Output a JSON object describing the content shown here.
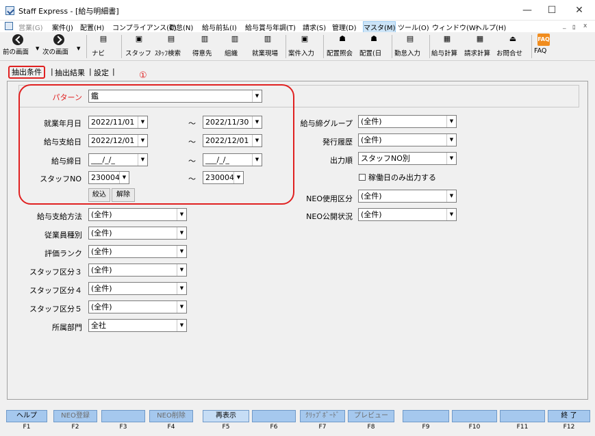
{
  "window": {
    "title": "Staff Express - [給与明細書]",
    "minimize": "—",
    "maximize": "☐",
    "close": "✕"
  },
  "menu": {
    "items": [
      "営業(G)",
      "案件(J)",
      "配置(H)",
      "コンプライアンス(C)",
      "勤怠(N)",
      "給与前払(I)",
      "給与賞与年調(T)",
      "請求(S)",
      "管理(D)",
      "マスタ(M)",
      "ツール(O)",
      "ウィンドウ(W)",
      "ヘルプ(H)"
    ],
    "mdi": [
      "_",
      "ﾛ",
      "x"
    ]
  },
  "toolbar": {
    "buttons": [
      "前の画面",
      "次の画面",
      "ナビ",
      "スタッフ",
      "ｽﾀｯﾌ検索",
      "得意先",
      "組織",
      "就業現場",
      "案件入力",
      "配置照会",
      "配置(日",
      "勤怠入力",
      "給与計算",
      "請求計算",
      "お問合せ",
      "FAQ"
    ],
    "faq_icon": "FAQ"
  },
  "tabs": [
    "抽出条件",
    "抽出結果",
    "設定"
  ],
  "annotation": "①",
  "form": {
    "pattern_label": "パターン",
    "pattern_value": "鑑",
    "work_date_label": "就業年月日",
    "work_date_from": "2022/11/01",
    "work_date_to": "2022/11/30",
    "pay_date_label": "給与支給日",
    "pay_date_from": "2022/12/01",
    "pay_date_to": "2022/12/01",
    "closing_date_label": "給与締日",
    "closing_date_from": "___/_/_",
    "closing_date_to": "___/_/_",
    "staff_no_label": "スタッフNO",
    "staff_no_from": "230004",
    "staff_no_to": "230004",
    "tilde": "～",
    "narrow_button": "絞込",
    "clear_button": "解除",
    "pay_method_label": "給与支給方法",
    "pay_method_value": "(全件)",
    "employee_type_label": "従業員種別",
    "employee_type_value": "(全件)",
    "rank_label": "評価ランク",
    "rank_value": "(全件)",
    "staff_cat3_label": "スタッフ区分３",
    "staff_cat3_value": "(全件)",
    "staff_cat4_label": "スタッフ区分４",
    "staff_cat4_value": "(全件)",
    "staff_cat5_label": "スタッフ区分５",
    "staff_cat5_value": "(全件)",
    "dept_label": "所属部門",
    "dept_value": "全社",
    "closing_group_label": "給与締グループ",
    "closing_group_value": "(全件)",
    "history_label": "発行履歴",
    "history_value": "(全件)",
    "order_label": "出力順",
    "order_value": "スタッフNO別",
    "work_days_only_label": "稼働日のみ出力する",
    "neo_use_label": "NEO使用区分",
    "neo_use_value": "(全件)",
    "neo_public_label": "NEO公開状況",
    "neo_public_value": "(全件)"
  },
  "fkeys": [
    {
      "label": "ヘルプ",
      "key": "F1"
    },
    {
      "label": "NEO登録",
      "key": "F2"
    },
    {
      "label": "",
      "key": "F3"
    },
    {
      "label": "NEO削除",
      "key": "F4"
    },
    {
      "label": "再表示",
      "key": "F5"
    },
    {
      "label": "",
      "key": "F6"
    },
    {
      "label": "ｸﾘｯﾌﾟﾎﾞｰﾄﾞ",
      "key": "F7"
    },
    {
      "label": "プレビュー",
      "key": "F8"
    },
    {
      "label": "",
      "key": "F9"
    },
    {
      "label": "",
      "key": "F10"
    },
    {
      "label": "",
      "key": "F11"
    },
    {
      "label": "終 了",
      "key": "F12"
    }
  ]
}
